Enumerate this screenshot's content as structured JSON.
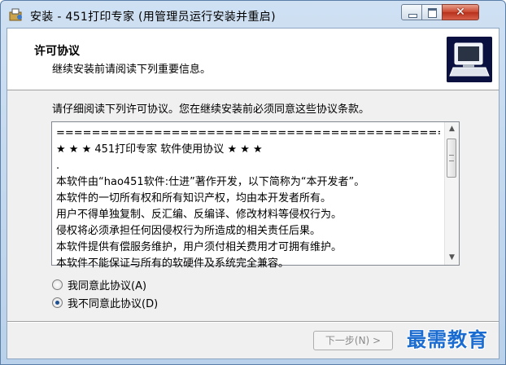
{
  "window": {
    "title": "安装 - 451打印专家 (用管理员运行安装并重启)",
    "close_glyph": "✕"
  },
  "header": {
    "title": "许可协议",
    "subtitle": "继续安装前请阅读下列重要信息。",
    "icon": "computer-install-icon"
  },
  "main": {
    "intro": "请仔细阅读下列许可协议。您在继续安装前必须同意这些协议条款。",
    "license_lines": [
      "================================================",
      "★ ★ ★   451打印专家 软件使用协议  ★ ★ ★",
      ".",
      "本软件由“hao451软件:仕进”著作开发，以下简称为“本开发者”。",
      "本软件的一切所有权和所有知识产权，均由本开发者所有。",
      "用户不得单独复制、反汇编、反编译、修改材料等侵权行为。",
      "侵权将必须承担任何因侵权行为所造成的相关责任后果。",
      "本软件提供有偿服务维护，用户须付相关费用才可拥有维护。",
      "本软件不能保证与所有的软硬件及系统完全兼容。"
    ],
    "scroll_up": "▲",
    "scroll_down": "▼",
    "accept_label": "我同意此协议(A)",
    "decline_label": "我不同意此协议(D)",
    "selected": "decline"
  },
  "footer": {
    "next_label": "下一步(N) >"
  },
  "watermark": "最需教育",
  "colors": {
    "accent": "#1d4f91",
    "watermark": "#1b6cd0",
    "title_bar": "#cfe0f3"
  }
}
